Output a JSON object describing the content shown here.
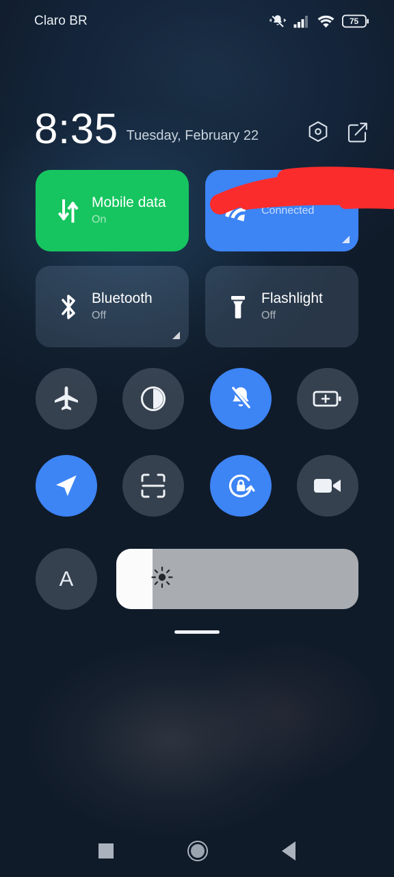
{
  "status_bar": {
    "carrier": "Claro BR",
    "battery_level": "75",
    "icons": [
      "notifications-silenced-icon",
      "cellular-signal-icon",
      "wifi-icon",
      "battery-icon"
    ]
  },
  "header": {
    "time": "8:35",
    "date": "Tuesday, February 22",
    "settings_icon": "settings-hexagon-icon",
    "edit_icon": "edit-tiles-icon"
  },
  "big_tiles": [
    {
      "name": "mobile-data",
      "title": "Mobile data",
      "subtitle": "On",
      "state": "on",
      "color": "#16c55f",
      "icon": "mobile-data-arrows-icon",
      "expandable": false,
      "redacted": false
    },
    {
      "name": "wifi",
      "title": "",
      "subtitle": "Connected",
      "state": "on",
      "color": "#3d84f5",
      "icon": "wifi-icon",
      "expandable": true,
      "redacted": true
    },
    {
      "name": "bluetooth",
      "title": "Bluetooth",
      "subtitle": "Off",
      "state": "off",
      "color": "rgba(140,165,195,0.20)",
      "icon": "bluetooth-icon",
      "expandable": true,
      "redacted": false
    },
    {
      "name": "flashlight",
      "title": "Flashlight",
      "subtitle": "Off",
      "state": "off",
      "color": "rgba(140,165,195,0.20)",
      "icon": "flashlight-icon",
      "expandable": false,
      "redacted": false
    }
  ],
  "circle_toggles_row1": [
    {
      "name": "airplane-mode",
      "icon": "airplane-icon",
      "state": "off"
    },
    {
      "name": "dark-mode",
      "icon": "contrast-circle-icon",
      "state": "off"
    },
    {
      "name": "silent-mode",
      "icon": "bell-muted-icon",
      "state": "on"
    },
    {
      "name": "battery-saver",
      "icon": "battery-plus-icon",
      "state": "off"
    }
  ],
  "circle_toggles_row2": [
    {
      "name": "location",
      "icon": "location-arrow-icon",
      "state": "on"
    },
    {
      "name": "scanner",
      "icon": "scan-frame-icon",
      "state": "off"
    },
    {
      "name": "rotation-lock",
      "icon": "rotation-lock-icon",
      "state": "on"
    },
    {
      "name": "screen-recorder",
      "icon": "video-camera-icon",
      "state": "off"
    }
  ],
  "brightness": {
    "auto_label": "A",
    "slider_icon": "brightness-sun-icon",
    "fill_percent": "15"
  },
  "nav_bar": {
    "recents": "recents-square-icon",
    "home": "home-circle-icon",
    "back": "back-triangle-icon"
  },
  "colors": {
    "active_blue": "#3d84f5",
    "active_green": "#16c55f",
    "redaction_red": "#fb2c2c",
    "background": "#101b29"
  }
}
